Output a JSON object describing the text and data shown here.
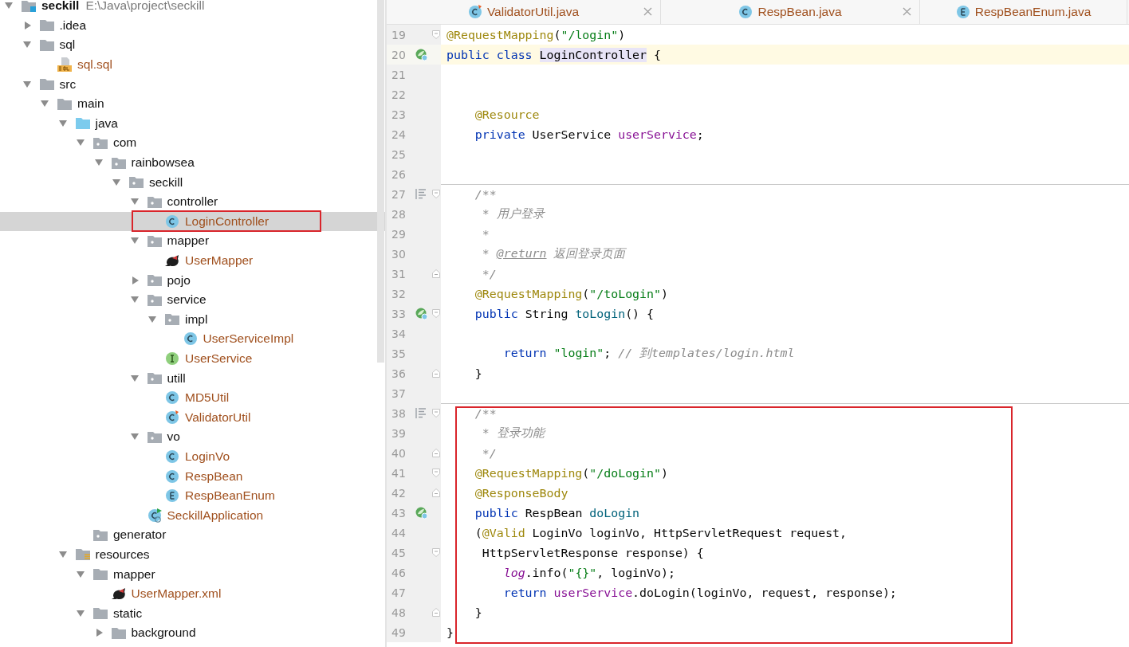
{
  "project_tree": {
    "root": {
      "label": "seckill",
      "path": "E:\\Java\\project\\seckill",
      "kind": "module",
      "expanded": true,
      "selected": false,
      "children": [
        {
          "label": ".idea",
          "kind": "folder",
          "expanded": false,
          "selected": false
        },
        {
          "label": "sql",
          "kind": "folder",
          "expanded": true,
          "selected": false,
          "children": [
            {
              "label": "sql.sql",
              "kind": "sql",
              "selected": false
            }
          ]
        },
        {
          "label": "src",
          "kind": "folder",
          "expanded": true,
          "selected": false,
          "children": [
            {
              "label": "main",
              "kind": "folder",
              "expanded": true,
              "selected": false,
              "children": [
                {
                  "label": "java",
                  "kind": "source",
                  "expanded": true,
                  "selected": false,
                  "children": [
                    {
                      "label": "com",
                      "kind": "package",
                      "expanded": true,
                      "selected": false,
                      "children": [
                        {
                          "label": "rainbowsea",
                          "kind": "package",
                          "expanded": true,
                          "selected": false,
                          "children": [
                            {
                              "label": "seckill",
                              "kind": "package",
                              "expanded": true,
                              "selected": false,
                              "children": [
                                {
                                  "label": "controller",
                                  "kind": "package",
                                  "expanded": true,
                                  "selected": false,
                                  "children": [
                                    {
                                      "label": "LoginController",
                                      "kind": "class",
                                      "selected": true,
                                      "boxed": true
                                    }
                                  ]
                                },
                                {
                                  "label": "mapper",
                                  "kind": "package",
                                  "expanded": true,
                                  "selected": false,
                                  "children": [
                                    {
                                      "label": "UserMapper",
                                      "kind": "mybatis",
                                      "selected": false
                                    }
                                  ]
                                },
                                {
                                  "label": "pojo",
                                  "kind": "package",
                                  "expanded": false,
                                  "selected": false
                                },
                                {
                                  "label": "service",
                                  "kind": "package",
                                  "expanded": true,
                                  "selected": false,
                                  "children": [
                                    {
                                      "label": "impl",
                                      "kind": "package",
                                      "expanded": true,
                                      "selected": false,
                                      "children": [
                                        {
                                          "label": "UserServiceImpl",
                                          "kind": "class",
                                          "selected": false
                                        }
                                      ]
                                    },
                                    {
                                      "label": "UserService",
                                      "kind": "interface",
                                      "selected": false
                                    }
                                  ]
                                },
                                {
                                  "label": "utill",
                                  "kind": "package",
                                  "expanded": true,
                                  "selected": false,
                                  "children": [
                                    {
                                      "label": "MD5Util",
                                      "kind": "class",
                                      "selected": false
                                    },
                                    {
                                      "label": "ValidatorUtil",
                                      "kind": "class-modified",
                                      "selected": false
                                    }
                                  ]
                                },
                                {
                                  "label": "vo",
                                  "kind": "package",
                                  "expanded": true,
                                  "selected": false,
                                  "children": [
                                    {
                                      "label": "LoginVo",
                                      "kind": "class",
                                      "selected": false
                                    },
                                    {
                                      "label": "RespBean",
                                      "kind": "class",
                                      "selected": false
                                    },
                                    {
                                      "label": "RespBeanEnum",
                                      "kind": "enum",
                                      "selected": false
                                    }
                                  ]
                                },
                                {
                                  "label": "SeckillApplication",
                                  "kind": "app-class",
                                  "selected": false
                                }
                              ]
                            }
                          ]
                        }
                      ]
                    },
                    {
                      "label": "generator",
                      "kind": "package",
                      "selected": false
                    }
                  ]
                },
                {
                  "label": "resources",
                  "kind": "resources",
                  "expanded": true,
                  "selected": false,
                  "children": [
                    {
                      "label": "mapper",
                      "kind": "folder",
                      "expanded": true,
                      "selected": false,
                      "children": [
                        {
                          "label": "UserMapper.xml",
                          "kind": "mybatis",
                          "selected": false
                        }
                      ]
                    },
                    {
                      "label": "static",
                      "kind": "folder",
                      "expanded": true,
                      "selected": false,
                      "children": [
                        {
                          "label": "background",
                          "kind": "folder",
                          "expanded": false,
                          "selected": false
                        }
                      ]
                    }
                  ]
                }
              ]
            }
          ]
        }
      ]
    }
  },
  "editor": {
    "tabs": [
      {
        "label": "ValidatorUtil.java",
        "kind": "class-modified",
        "selected": false,
        "closable": true
      },
      {
        "label": "RespBean.java",
        "kind": "class",
        "selected": false,
        "closable": true
      },
      {
        "label": "RespBeanEnum.java",
        "kind": "enum",
        "selected": false,
        "closable": false
      }
    ],
    "blocks": [
      {
        "boxed": false,
        "lines": [
          {
            "number": "19",
            "fold_open": true,
            "tokens": [
              {
                "kind": "ann",
                "text": "@RequestMapping"
              },
              {
                "kind": "plain",
                "text": "("
              },
              {
                "kind": "str",
                "text": "\"/login\""
              },
              {
                "kind": "plain",
                "text": ")"
              }
            ]
          },
          {
            "number": "20",
            "current": true,
            "bean_marker": true,
            "tokens": [
              {
                "kind": "kw",
                "text": "public class "
              },
              {
                "kind": "hl",
                "text": "LoginController"
              },
              {
                "kind": "plain",
                "text": " {"
              }
            ]
          },
          {
            "number": "21"
          },
          {
            "number": "22"
          },
          {
            "number": "23",
            "tokens": [
              {
                "kind": "ann",
                "text": "    @Resource"
              }
            ]
          },
          {
            "number": "24",
            "tokens": [
              {
                "kind": "kw",
                "text": "    private "
              },
              {
                "kind": "plain",
                "text": "UserService "
              },
              {
                "kind": "field",
                "text": "userService"
              },
              {
                "kind": "plain",
                "text": ";"
              }
            ]
          },
          {
            "number": "25"
          },
          {
            "number": "26"
          },
          {
            "number": "27",
            "separator": true,
            "doc_marker": true,
            "fold_open": true,
            "tokens": [
              {
                "kind": "comment",
                "text": "    /**"
              }
            ]
          },
          {
            "number": "28",
            "tokens": [
              {
                "kind": "comment",
                "text": "     * 用户登录"
              }
            ]
          },
          {
            "number": "29",
            "tokens": [
              {
                "kind": "comment",
                "text": "     *"
              }
            ]
          },
          {
            "number": "30",
            "tokens": [
              {
                "kind": "comment",
                "text": "     * "
              },
              {
                "kind": "doctag",
                "text": "@return"
              },
              {
                "kind": "comment",
                "text": " 返回登录页面"
              }
            ]
          },
          {
            "number": "31",
            "fold_close": true,
            "tokens": [
              {
                "kind": "comment",
                "text": "     */"
              }
            ]
          },
          {
            "number": "32",
            "tokens": [
              {
                "kind": "ann",
                "text": "    @RequestMapping"
              },
              {
                "kind": "plain",
                "text": "("
              },
              {
                "kind": "str",
                "text": "\"/toLogin\""
              },
              {
                "kind": "plain",
                "text": ")"
              }
            ]
          },
          {
            "number": "33",
            "bean_marker": true,
            "fold_open": true,
            "tokens": [
              {
                "kind": "kw",
                "text": "    public "
              },
              {
                "kind": "plain",
                "text": "String "
              },
              {
                "kind": "method",
                "text": "toLogin"
              },
              {
                "kind": "plain",
                "text": "() {"
              }
            ]
          },
          {
            "number": "34"
          },
          {
            "number": "35",
            "tokens": [
              {
                "kind": "kw",
                "text": "        return "
              },
              {
                "kind": "str",
                "text": "\"login\""
              },
              {
                "kind": "plain",
                "text": "; "
              },
              {
                "kind": "comment",
                "text": "// 到templates/login.html"
              }
            ]
          },
          {
            "number": "36",
            "fold_close": true,
            "tokens": [
              {
                "kind": "plain",
                "text": "    }"
              }
            ]
          },
          {
            "number": "37"
          }
        ]
      },
      {
        "boxed": true,
        "lines": [
          {
            "number": "38",
            "separator": true,
            "doc_marker": true,
            "fold_open": true,
            "tokens": [
              {
                "kind": "comment",
                "text": "    /**"
              }
            ]
          },
          {
            "number": "39",
            "tokens": [
              {
                "kind": "comment",
                "text": "     * 登录功能"
              }
            ]
          },
          {
            "number": "40",
            "fold_close": true,
            "tokens": [
              {
                "kind": "comment",
                "text": "     */"
              }
            ]
          },
          {
            "number": "41",
            "fold_open": true,
            "tokens": [
              {
                "kind": "ann",
                "text": "    @RequestMapping"
              },
              {
                "kind": "plain",
                "text": "("
              },
              {
                "kind": "str",
                "text": "\"/doLogin\""
              },
              {
                "kind": "plain",
                "text": ")"
              }
            ]
          },
          {
            "number": "42",
            "fold_close": true,
            "tokens": [
              {
                "kind": "ann",
                "text": "    @ResponseBody"
              }
            ]
          },
          {
            "number": "43",
            "bean_marker": true,
            "tokens": [
              {
                "kind": "kw",
                "text": "    public "
              },
              {
                "kind": "plain",
                "text": "RespBean "
              },
              {
                "kind": "method",
                "text": "doLogin"
              }
            ]
          },
          {
            "number": "44",
            "tokens": [
              {
                "kind": "plain",
                "text": "    ("
              },
              {
                "kind": "ann",
                "text": "@Valid"
              },
              {
                "kind": "plain",
                "text": " LoginVo loginVo, HttpServletRequest request,"
              }
            ]
          },
          {
            "number": "45",
            "fold_open": true,
            "tokens": [
              {
                "kind": "plain",
                "text": "     HttpServletResponse response) {"
              }
            ]
          },
          {
            "number": "46",
            "tokens": [
              {
                "kind": "static",
                "text": "        log"
              },
              {
                "kind": "plain",
                "text": ".info("
              },
              {
                "kind": "str",
                "text": "\"{}\""
              },
              {
                "kind": "plain",
                "text": ", loginVo);"
              }
            ]
          },
          {
            "number": "47",
            "tokens": [
              {
                "kind": "kw",
                "text": "        return "
              },
              {
                "kind": "field",
                "text": "userService"
              },
              {
                "kind": "plain",
                "text": ".doLogin(loginVo, request, response);"
              }
            ]
          },
          {
            "number": "48",
            "fold_close": true,
            "tokens": [
              {
                "kind": "plain",
                "text": "    }"
              }
            ]
          },
          {
            "number": "49",
            "tokens": [
              {
                "kind": "plain",
                "text": "}"
              }
            ]
          }
        ]
      }
    ]
  }
}
